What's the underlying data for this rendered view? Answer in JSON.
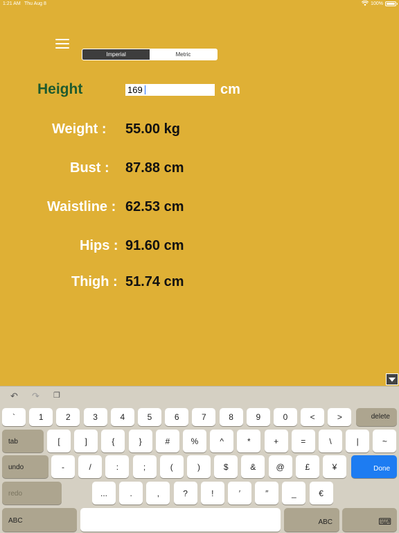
{
  "status": {
    "time": "1:21 AM",
    "date": "Thu Aug 8",
    "battery": "100%",
    "battery_level": 1.0
  },
  "segments": {
    "imperial": "Imperial",
    "metric": "Metric",
    "selected": "Imperial"
  },
  "height": {
    "label": "Height",
    "value": "169",
    "unit": "cm"
  },
  "measurements": [
    {
      "label": "Weight :",
      "value": "55.00 kg"
    },
    {
      "label": "Bust :",
      "value": "87.88 cm"
    },
    {
      "label": "Waistline :",
      "value": "62.53 cm"
    },
    {
      "label": "Hips :",
      "value": "91.60 cm"
    },
    {
      "label": "Thigh :",
      "value": "51.74 cm"
    }
  ],
  "keyboard": {
    "row1": [
      "`",
      "1",
      "2",
      "3",
      "4",
      "5",
      "6",
      "7",
      "8",
      "9",
      "0",
      "<",
      ">"
    ],
    "delete": "delete",
    "tab": "tab",
    "row2": [
      "[",
      "]",
      "{",
      "}",
      "#",
      "%",
      "^",
      "*",
      "+",
      "=",
      "\\",
      "|",
      "~"
    ],
    "undo": "undo",
    "row3": [
      "-",
      "/",
      ":",
      ";",
      "(",
      ")",
      "$",
      "&",
      "@",
      "£",
      "¥"
    ],
    "done": "Done",
    "redo": "redo",
    "row4": [
      "...",
      ".",
      ",",
      "?",
      "!",
      "′",
      "″",
      "_",
      "€"
    ],
    "abc_left": "ABC",
    "abc_right": "ABC"
  }
}
